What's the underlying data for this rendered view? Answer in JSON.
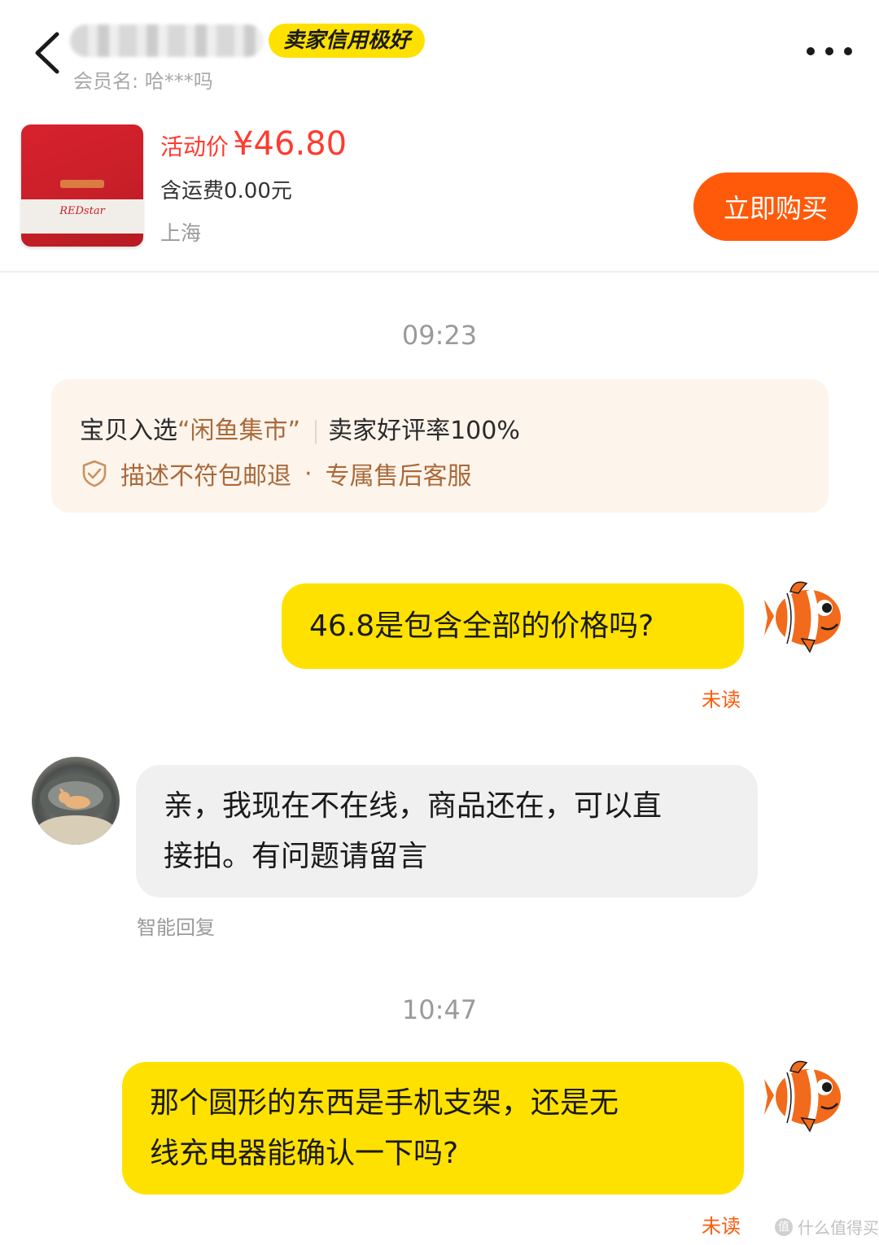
{
  "header": {
    "nickname": "",
    "credit_badge": "卖家信用极好",
    "member_name": "会员名: 哈***吗"
  },
  "product": {
    "price_label": "活动价",
    "price_value": "¥46.80",
    "shipping": "含运费0.00元",
    "location": "上海",
    "buy_button": "立即购买",
    "thumbnail_text": "REDstar"
  },
  "chat": {
    "timestamp_1": "09:23",
    "notice": {
      "line1_prefix": "宝贝入选",
      "line1_highlight": "“闲鱼集市”",
      "line1_rating": "卖家好评率100%",
      "line2_item1": "描述不符包邮退",
      "line2_sep": "·",
      "line2_item2": "专属售后客服"
    },
    "msg_1": "46.8是包含全部的价格吗?",
    "msg_1_status": "未读",
    "reply_1_line1": "亲，我现在不在线，商品还在，可以直",
    "reply_1_line2": "接拍。有问题请留言",
    "reply_1_tag": "智能回复",
    "timestamp_2": "10:47",
    "msg_2_line1": "那个圆形的东西是手机支架，还是无",
    "msg_2_line2": "线充电器能确认一下吗?",
    "msg_2_status": "未读"
  },
  "watermark": "什么值得买",
  "colors": {
    "accent_yellow": "#ffe100",
    "buy_orange": "#ff5a0a",
    "price_red": "#ff3b30",
    "notice_brown": "#a96a3a"
  },
  "icons": [
    "back-icon",
    "more-icon",
    "shield-check-icon",
    "clownfish-avatar",
    "cat-avatar"
  ]
}
